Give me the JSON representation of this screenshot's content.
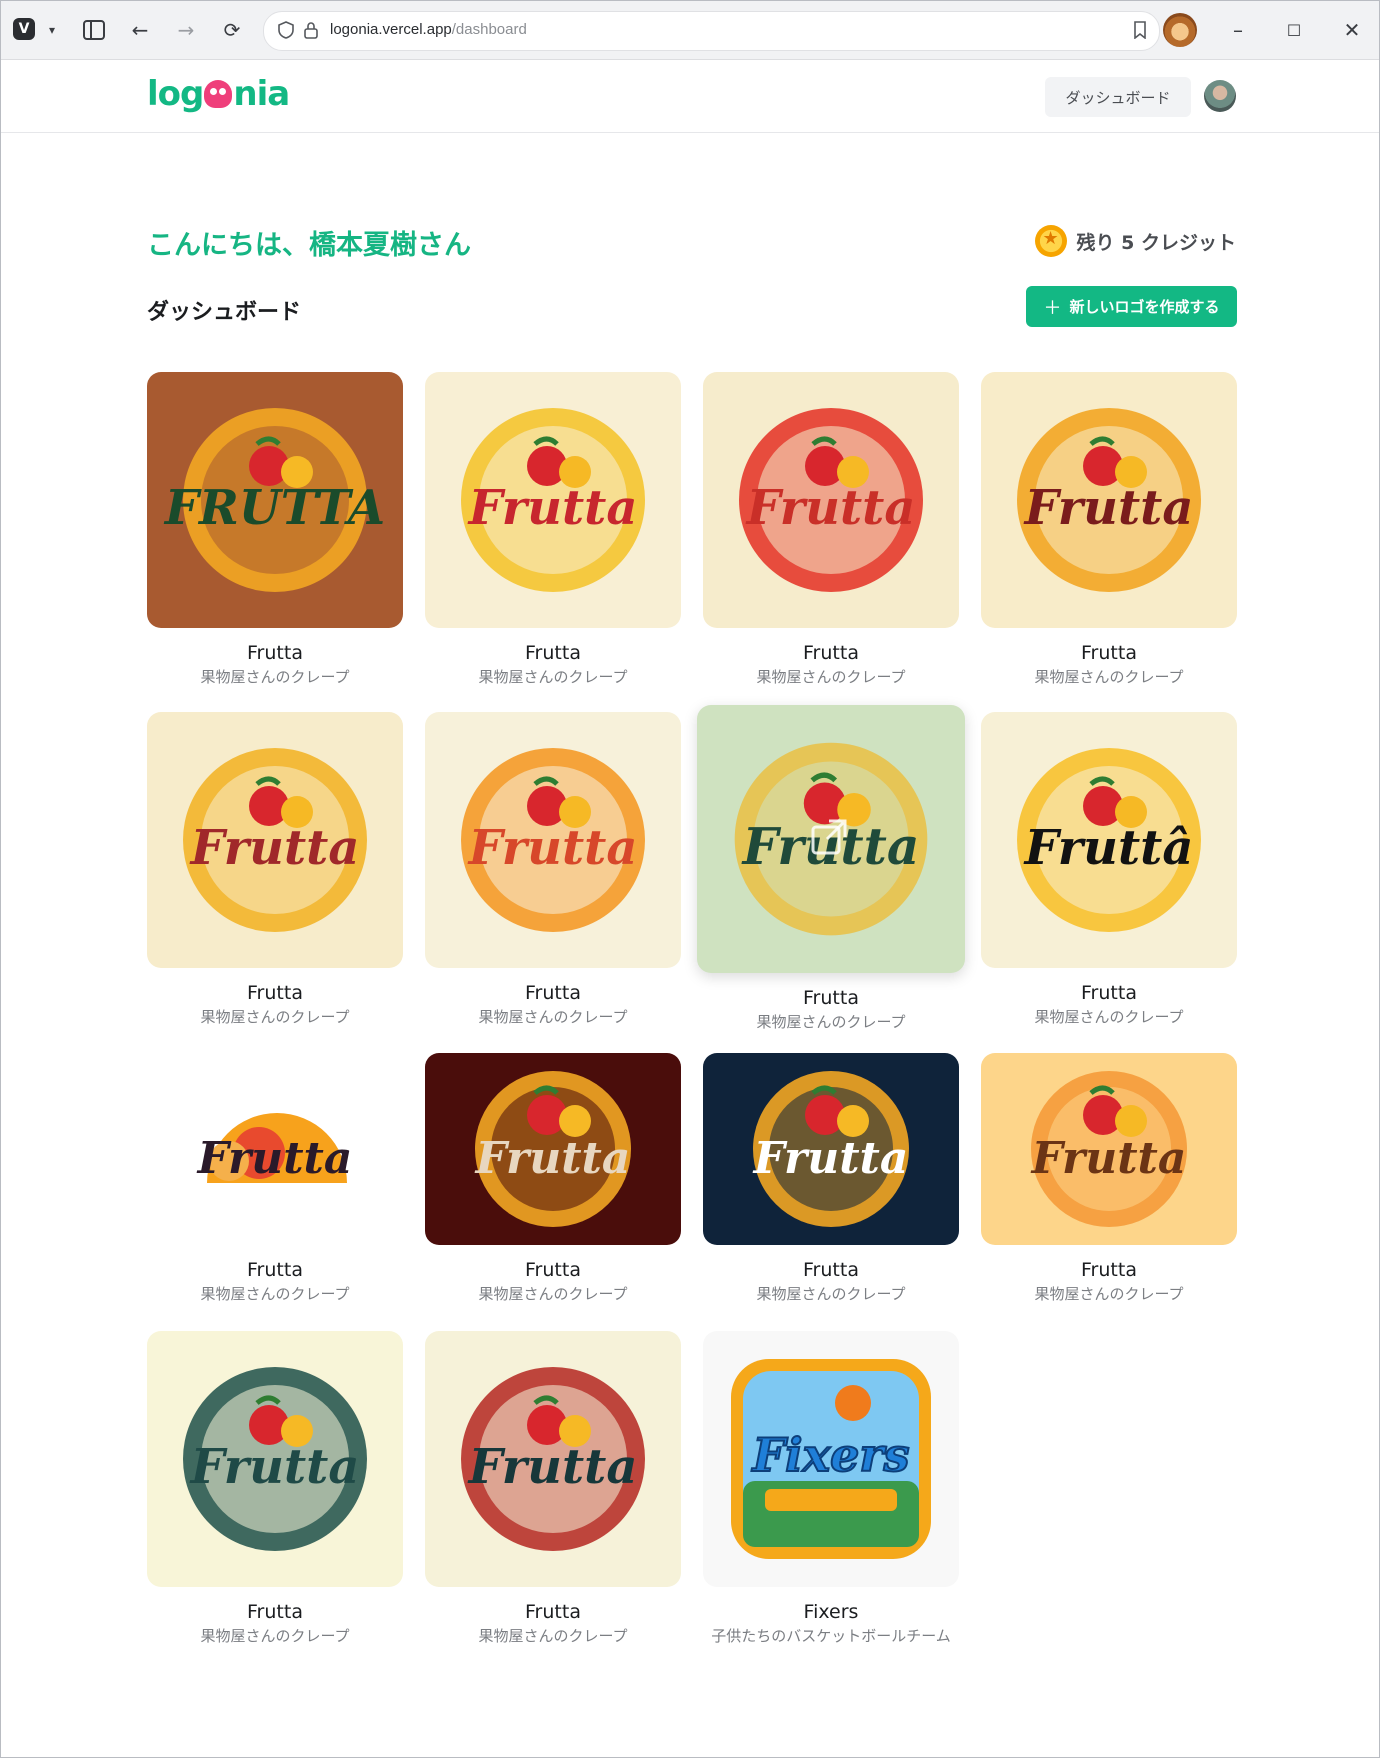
{
  "browser": {
    "url_host": "logonia.vercel.app",
    "url_path": "/dashboard",
    "url_scheme": ""
  },
  "header": {
    "brand": "logonia",
    "dashboard_button": "ダッシュボード"
  },
  "main": {
    "greeting": "こんにちは、橋本夏樹さん",
    "credits_label": "残り 5 クレジット",
    "section_title": "ダッシュボード",
    "new_logo_button": "新しいロゴを作成する"
  },
  "logos": [
    {
      "title": "Frutta",
      "subtitle": "果物屋さんのクレープ",
      "bg": "#a85a30",
      "text": "FRUTTA",
      "accent": "#f2a623",
      "ink": "#1a4b2b",
      "variant": "sun"
    },
    {
      "title": "Frutta",
      "subtitle": "果物屋さんのクレープ",
      "bg": "#f8efd4",
      "text": "Frutta",
      "accent": "#f4c430",
      "ink": "#c7262e",
      "variant": "burst"
    },
    {
      "title": "Frutta",
      "subtitle": "果物屋さんのクレープ",
      "bg": "#f6eccc",
      "text": "Frutta",
      "accent": "#e53b2e",
      "ink": "#c92f28",
      "variant": "plain"
    },
    {
      "title": "Frutta",
      "subtitle": "果物屋さんのクレープ",
      "bg": "#f8ecc9",
      "text": "Frutta",
      "accent": "#f2a623",
      "ink": "#7a1c1c",
      "variant": "cone"
    },
    {
      "title": "Frutta",
      "subtitle": "果物屋さんのクレープ",
      "bg": "#f7eccb",
      "text": "Frutta",
      "accent": "#f2b52a",
      "ink": "#a0282a",
      "variant": "badge"
    },
    {
      "title": "Frutta",
      "subtitle": "果物屋さんのクレープ",
      "bg": "#f7f1da",
      "text": "Frutta",
      "accent": "#f49a28",
      "ink": "#d7472a",
      "variant": "arch"
    },
    {
      "title": "Frutta",
      "subtitle": "果物屋さんのクレープ",
      "bg": "#cfe2c0",
      "text": "Frutta",
      "accent": "#e8c24a",
      "ink": "#1f4a3a",
      "variant": "crepe"
    },
    {
      "title": "Frutta",
      "subtitle": "果物屋さんのクレープ",
      "bg": "#f7f0d6",
      "text": "Fruttâ",
      "accent": "#f7c12f",
      "ink": "#121212",
      "variant": "ring"
    },
    {
      "title": "Frutta",
      "subtitle": "果物屋さんのクレープ",
      "bg": "#ffffff",
      "text": "Frutta",
      "accent": "#f7a21c",
      "ink": "#2a1a2a",
      "variant": "halfsun"
    },
    {
      "title": "Frutta",
      "subtitle": "果物屋さんのクレープ",
      "bg": "#4a0d0b",
      "text": "Frutta",
      "accent": "#f2a623",
      "ink": "#e8d7c0",
      "variant": "dark"
    },
    {
      "title": "Frutta",
      "subtitle": "果物屋さんのクレープ",
      "bg": "#0f233a",
      "text": "Frutta",
      "accent": "#f2a623",
      "ink": "#ffffff",
      "variant": "navy"
    },
    {
      "title": "Frutta",
      "subtitle": "果物屋さんのクレープ",
      "bg": "#fdd58a",
      "text": "Frutta",
      "accent": "#f59b3a",
      "ink": "#6b3415",
      "variant": "stall"
    },
    {
      "title": "Frutta",
      "subtitle": "果物屋さんのクレープ",
      "bg": "#f8f5d8",
      "text": "Frutta",
      "accent": "#2a5a52",
      "ink": "#1f4a47",
      "variant": "stamp"
    },
    {
      "title": "Frutta",
      "subtitle": "果物屋さんのクレープ",
      "bg": "#f6f2d9",
      "text": "Frutta",
      "accent": "#b8322a",
      "ink": "#17373a",
      "variant": "vintage"
    },
    {
      "title": "Fixers",
      "subtitle": "子供たちのバスケットボールチーム",
      "bg": "#f8f8f8",
      "text": "Fixers",
      "accent": "#f5a81a",
      "ink": "#1f7fd8",
      "variant": "app"
    }
  ]
}
